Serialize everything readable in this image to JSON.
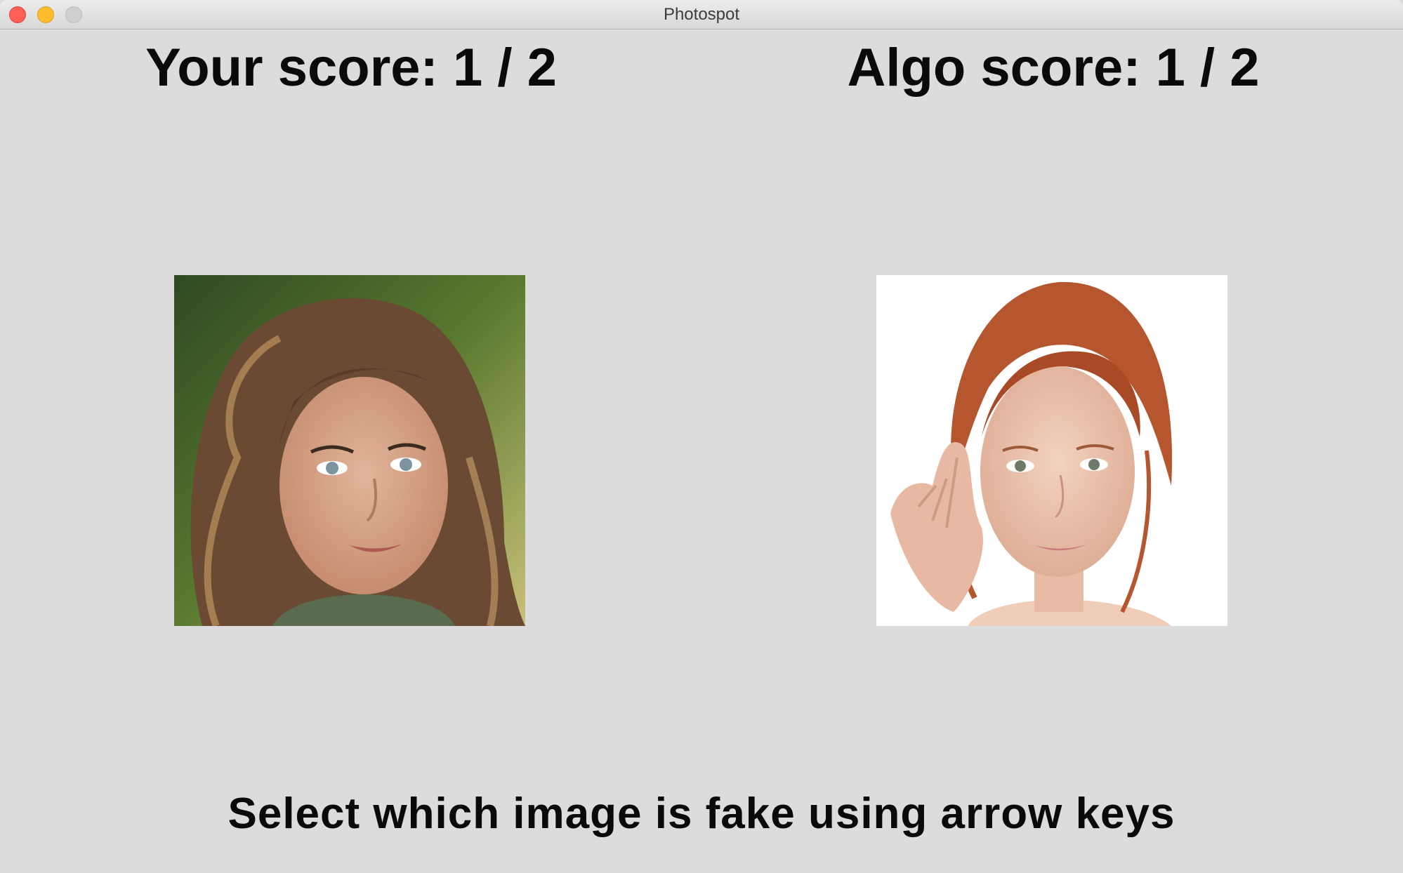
{
  "window": {
    "title": "Photospot",
    "controls": [
      "close-icon",
      "minimize-icon",
      "zoom-icon"
    ],
    "background": "#dcdcde"
  },
  "scores": {
    "user": "Your score: 1 / 2",
    "algo": "Algo score: 1 / 2"
  },
  "images": [
    {
      "name": "left-face-photo",
      "subject": "woman with long curly brown hair, green background"
    },
    {
      "name": "right-face-photo",
      "subject": "woman with red hair, hand near face, white background"
    }
  ],
  "instruction": "Select which image is fake using arrow keys"
}
